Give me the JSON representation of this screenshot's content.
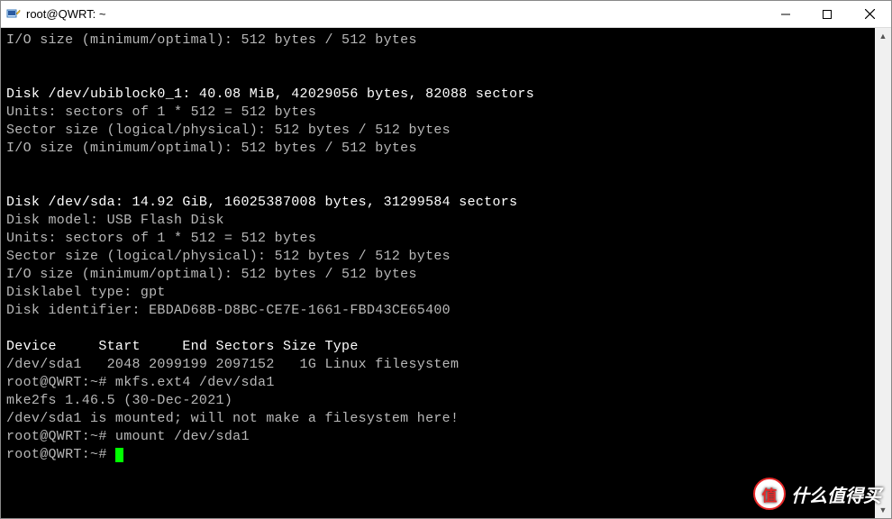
{
  "window": {
    "title": "root@QWRT: ~"
  },
  "terminal": {
    "lines": [
      "I/O size (minimum/optimal): 512 bytes / 512 bytes",
      "",
      "",
      "Disk /dev/ubiblock0_1: 40.08 MiB, 42029056 bytes, 82088 sectors",
      "Units: sectors of 1 * 512 = 512 bytes",
      "Sector size (logical/physical): 512 bytes / 512 bytes",
      "I/O size (minimum/optimal): 512 bytes / 512 bytes",
      "",
      "",
      "Disk /dev/sda: 14.92 GiB, 16025387008 bytes, 31299584 sectors",
      "Disk model: USB Flash Disk",
      "Units: sectors of 1 * 512 = 512 bytes",
      "Sector size (logical/physical): 512 bytes / 512 bytes",
      "I/O size (minimum/optimal): 512 bytes / 512 bytes",
      "Disklabel type: gpt",
      "Disk identifier: EBDAD68B-D8BC-CE7E-1661-FBD43CE65400",
      "",
      "Device     Start     End Sectors Size Type",
      "/dev/sda1   2048 2099199 2097152   1G Linux filesystem",
      "root@QWRT:~# mkfs.ext4 /dev/sda1",
      "mke2fs 1.46.5 (30-Dec-2021)",
      "/dev/sda1 is mounted; will not make a filesystem here!",
      "root@QWRT:~# umount /dev/sda1",
      "root@QWRT:~# "
    ],
    "highlightLines": [
      3,
      9,
      17
    ]
  },
  "watermark": {
    "circle": "值",
    "text": "什么值得买"
  }
}
